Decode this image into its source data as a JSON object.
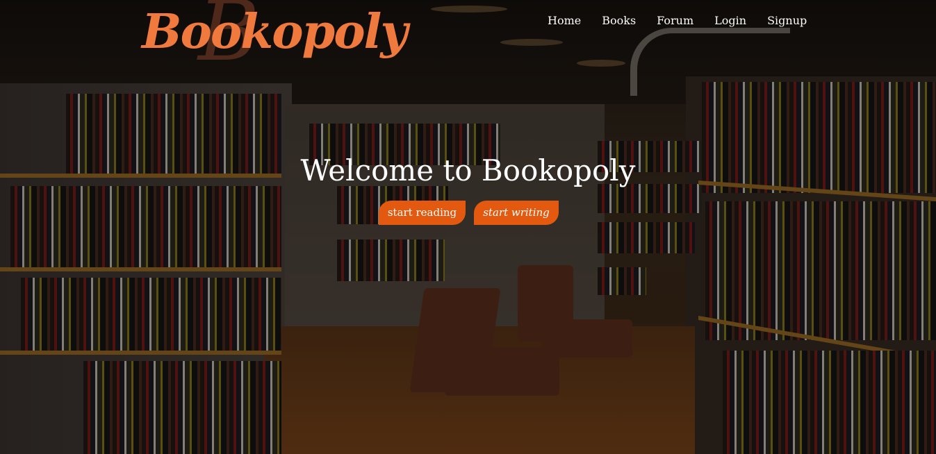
{
  "brand": {
    "logo_text": "Bookopoly",
    "logo_initial": "B",
    "color": "#f07a3e"
  },
  "nav": {
    "items": [
      "Home",
      "Books",
      "Forum",
      "Login",
      "Signup"
    ]
  },
  "hero": {
    "title": "Welcome to Bookopoly",
    "primary_button": "start reading",
    "secondary_button": "start writing",
    "button_color": "#e2590f"
  }
}
